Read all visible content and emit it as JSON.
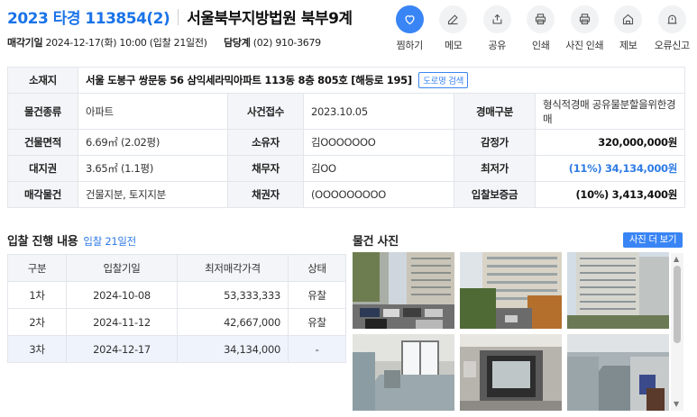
{
  "header": {
    "case_number": "2023 타경 113854(2)",
    "court": "서울북부지방법원 북부9계",
    "sale_date_label": "매각기일",
    "sale_date_value": "2024-12-17(화) 10:00 (입찰 21일전)",
    "officer_label": "담당계",
    "officer_value": "(02) 910-3679"
  },
  "actions": [
    {
      "label": "찜하기",
      "icon": "heart-icon"
    },
    {
      "label": "메모",
      "icon": "edit-icon"
    },
    {
      "label": "공유",
      "icon": "share-icon"
    },
    {
      "label": "인쇄",
      "icon": "print-icon"
    },
    {
      "label": "사진 인쇄",
      "icon": "print-photo-icon"
    },
    {
      "label": "제보",
      "icon": "home-icon"
    },
    {
      "label": "오류신고",
      "icon": "alert-icon"
    }
  ],
  "info": {
    "address_label": "소재지",
    "address_value": "서울 도봉구 쌍문동 56 삼익세라믹아파트 113동 8층 805호 [해등로 195]",
    "road_search": "도로명 검색",
    "type_label": "물건종류",
    "type_value": "아파트",
    "received_label": "사건접수",
    "received_value": "2023.10.05",
    "auction_kind_label": "경매구분",
    "auction_kind_value": "형식적경매 공유물분할을위한경매",
    "building_area_label": "건물면적",
    "building_area_value": "6.69㎡ (2.02평)",
    "owner_label": "소유자",
    "owner_value": "김OOOOOOO",
    "appraisal_label": "감정가",
    "appraisal_value": "320,000,000원",
    "land_right_label": "대지권",
    "land_right_value": "3.65㎡ (1.1평)",
    "debtor_label": "채무자",
    "debtor_value": "김OO",
    "min_price_label": "최저가",
    "min_price_value": "(11%) 34,134,000원",
    "sale_items_label": "매각물건",
    "sale_items_value": "건물지분, 토지지분",
    "creditor_label": "채권자",
    "creditor_value": "(OOOOOOOOO",
    "deposit_label": "입찰보증금",
    "deposit_value": "(10%) 3,413,400원"
  },
  "bids": {
    "title": "입찰 진행 내용",
    "note": "입찰 21일전",
    "headers": [
      "구분",
      "입찰기일",
      "최저매각가격",
      "상태"
    ],
    "rows": [
      {
        "round": "1차",
        "date": "2024-10-08",
        "price": "53,333,333",
        "status": "유찰"
      },
      {
        "round": "2차",
        "date": "2024-11-12",
        "price": "42,667,000",
        "status": "유찰"
      },
      {
        "round": "3차",
        "date": "2024-12-17",
        "price": "34,134,000",
        "status": "-"
      }
    ]
  },
  "photos": {
    "title": "물건 사진",
    "more_button": "사진 더 보기"
  }
}
